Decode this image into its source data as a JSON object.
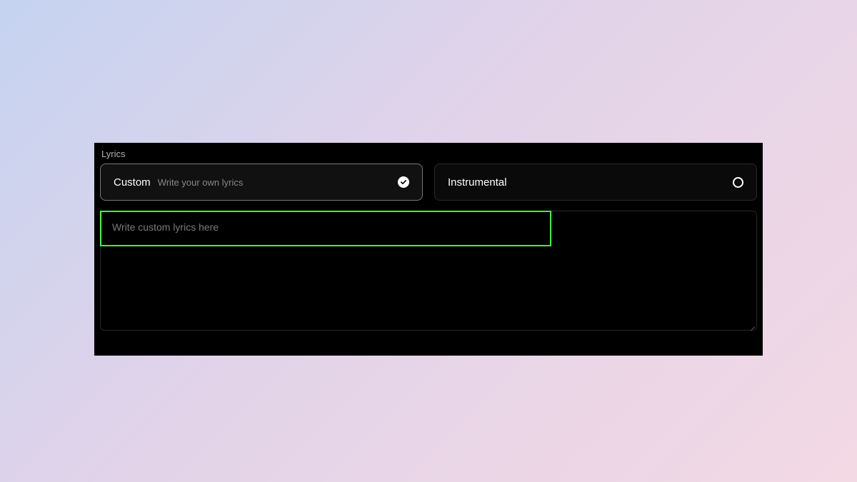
{
  "section": {
    "label": "Lyrics"
  },
  "options": {
    "custom": {
      "title": "Custom",
      "subtitle": "Write your own lyrics",
      "selected": true
    },
    "instrumental": {
      "title": "Instrumental",
      "selected": false
    }
  },
  "textarea": {
    "placeholder": "Write custom lyrics here",
    "value": ""
  },
  "colors": {
    "highlight": "#3cff3c",
    "panel_bg": "#000000"
  }
}
